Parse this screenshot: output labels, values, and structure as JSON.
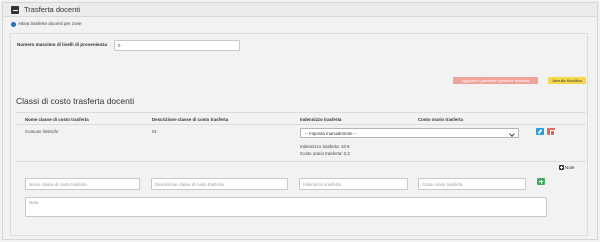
{
  "panel": {
    "title": "Trasferta docenti"
  },
  "radio": {
    "label": "Attiva trasferte docenti per zone"
  },
  "max_levels": {
    "label": "Numero massimo di livelli di provenienza",
    "value": "0"
  },
  "buttons": {
    "update_label": "Aggiorna i parametri gestione trasferte",
    "cancel_label": "Annulla Modifica"
  },
  "section": {
    "title": "Classi di costo trasferta docenti"
  },
  "table": {
    "headers": [
      "Nome classe di costo trasferta",
      "Descrizione classe di costo trasferta",
      "Indennizzo trasferta",
      "Costo orario trasferta"
    ],
    "rows": [
      {
        "name": "Comune limitrofo",
        "description": "01",
        "select_value": "-- Imposta manualmente --",
        "indennizzo_line": "Indennizzo trasferta: 10 €",
        "costo_line": "Costo orario trasferta: 0,2"
      }
    ]
  },
  "note_toggle": {
    "label": "Note"
  },
  "new_row": {
    "name_placeholder": "Nome classe di costo trasferta",
    "description_placeholder": "Descrizione classe di costo trasferta",
    "indennizzo_placeholder": "Indennizzo trasferta",
    "costo_placeholder": "Costo orario trasferta",
    "note_placeholder": "Nota"
  },
  "colors": {
    "accent_blue": "#2a9bd8",
    "delete_red": "#e06a5c",
    "add_green": "#4aa863",
    "update_button": "#f0a29a",
    "cancel_button": "#f4d84a"
  },
  "icons": {
    "collapse": "minus-square-icon",
    "edit": "pencil-icon",
    "delete": "trash-icon",
    "add": "plus-icon",
    "note": "plus-square-icon"
  }
}
